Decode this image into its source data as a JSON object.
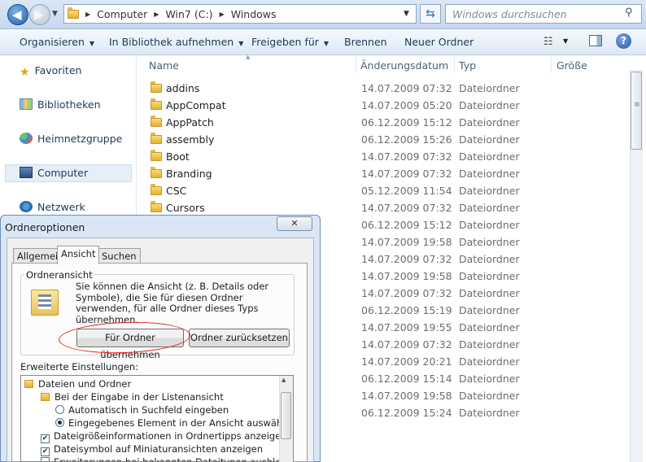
{
  "address": {
    "crumbs": [
      "Computer",
      "Win7 (C:)",
      "Windows"
    ],
    "search_placeholder": "Windows durchsuchen"
  },
  "toolbar": {
    "organize": "Organisieren",
    "include": "In Bibliothek aufnehmen",
    "share": "Freigeben für",
    "burn": "Brennen",
    "new_folder": "Neuer Ordner"
  },
  "sidebar": {
    "items": [
      {
        "label": "Favoriten",
        "icon": "star-icon"
      },
      {
        "label": "Bibliotheken",
        "icon": "library-icon"
      },
      {
        "label": "Heimnetzgruppe",
        "icon": "homegroup-icon"
      },
      {
        "label": "Computer",
        "icon": "computer-icon"
      },
      {
        "label": "Netzwerk",
        "icon": "network-icon"
      }
    ]
  },
  "columns": {
    "name": "Name",
    "date": "Änderungsdatum",
    "type": "Typ",
    "size": "Größe"
  },
  "files": [
    {
      "name": "addins",
      "date": "14.07.2009 07:32",
      "type": "Dateiordner"
    },
    {
      "name": "AppCompat",
      "date": "14.07.2009 05:20",
      "type": "Dateiordner"
    },
    {
      "name": "AppPatch",
      "date": "06.12.2009 15:12",
      "type": "Dateiordner"
    },
    {
      "name": "assembly",
      "date": "06.12.2009 15:26",
      "type": "Dateiordner"
    },
    {
      "name": "Boot",
      "date": "14.07.2009 07:32",
      "type": "Dateiordner"
    },
    {
      "name": "Branding",
      "date": "14.07.2009 07:32",
      "type": "Dateiordner"
    },
    {
      "name": "CSC",
      "date": "05.12.2009 11:54",
      "type": "Dateiordner"
    },
    {
      "name": "Cursors",
      "date": "14.07.2009 07:32",
      "type": "Dateiordner"
    },
    {
      "name": "",
      "date": "06.12.2009 15:12",
      "type": "Dateiordner"
    },
    {
      "name": "",
      "date": "14.07.2009 19:58",
      "type": "Dateiordner"
    },
    {
      "name": "",
      "date": "14.07.2009 07:32",
      "type": "Dateiordner"
    },
    {
      "name": "",
      "date": "14.07.2009 19:58",
      "type": "Dateiordner"
    },
    {
      "name": "",
      "date": "14.07.2009 07:32",
      "type": "Dateiordner"
    },
    {
      "name": "",
      "date": "06.12.2009 15:19",
      "type": "Dateiordner"
    },
    {
      "name": "",
      "date": "14.07.2009 19:55",
      "type": "Dateiordner"
    },
    {
      "name": "",
      "date": "14.07.2009 07:32",
      "type": "Dateiordner"
    },
    {
      "name": "",
      "date": "14.07.2009 20:21",
      "type": "Dateiordner"
    },
    {
      "name": "",
      "date": "06.12.2009 15:14",
      "type": "Dateiordner"
    },
    {
      "name": "",
      "date": "14.07.2009 19:58",
      "type": "Dateiordner"
    },
    {
      "name": "",
      "date": "06.12.2009 15:24",
      "type": "Dateiordner"
    }
  ],
  "dialog": {
    "title": "Ordneroptionen",
    "tabs": [
      "Allgemein",
      "Ansicht",
      "Suchen"
    ],
    "group_title": "Ordneransicht",
    "group_text": "Sie können die Ansicht (z. B. Details oder Symbole), die Sie für diesen Ordner verwenden, für alle Ordner dieses Typs übernehmen.",
    "apply_button": "Für Ordner übernehmen",
    "reset_button": "Ordner zurücksetzen",
    "advanced_label": "Erweiterte Einstellungen:",
    "tree": [
      {
        "kind": "folder",
        "label": "Dateien und Ordner"
      },
      {
        "kind": "folder",
        "label": "Bei der Eingabe in der Listenansicht"
      },
      {
        "kind": "radio",
        "checked": false,
        "label": "Automatisch in Suchfeld eingeben"
      },
      {
        "kind": "radio",
        "checked": true,
        "label": "Eingegebenes Element in der Ansicht auswählen"
      },
      {
        "kind": "check",
        "checked": true,
        "label": "Dateigrößeinformationen in Ordnertipps anzeigen"
      },
      {
        "kind": "check",
        "checked": true,
        "label": "Dateisymbol auf Miniaturansichten anzeigen"
      },
      {
        "kind": "check",
        "checked": false,
        "label": "Erweiterungen bei bekannten Dateitypen ausblenden"
      }
    ]
  }
}
